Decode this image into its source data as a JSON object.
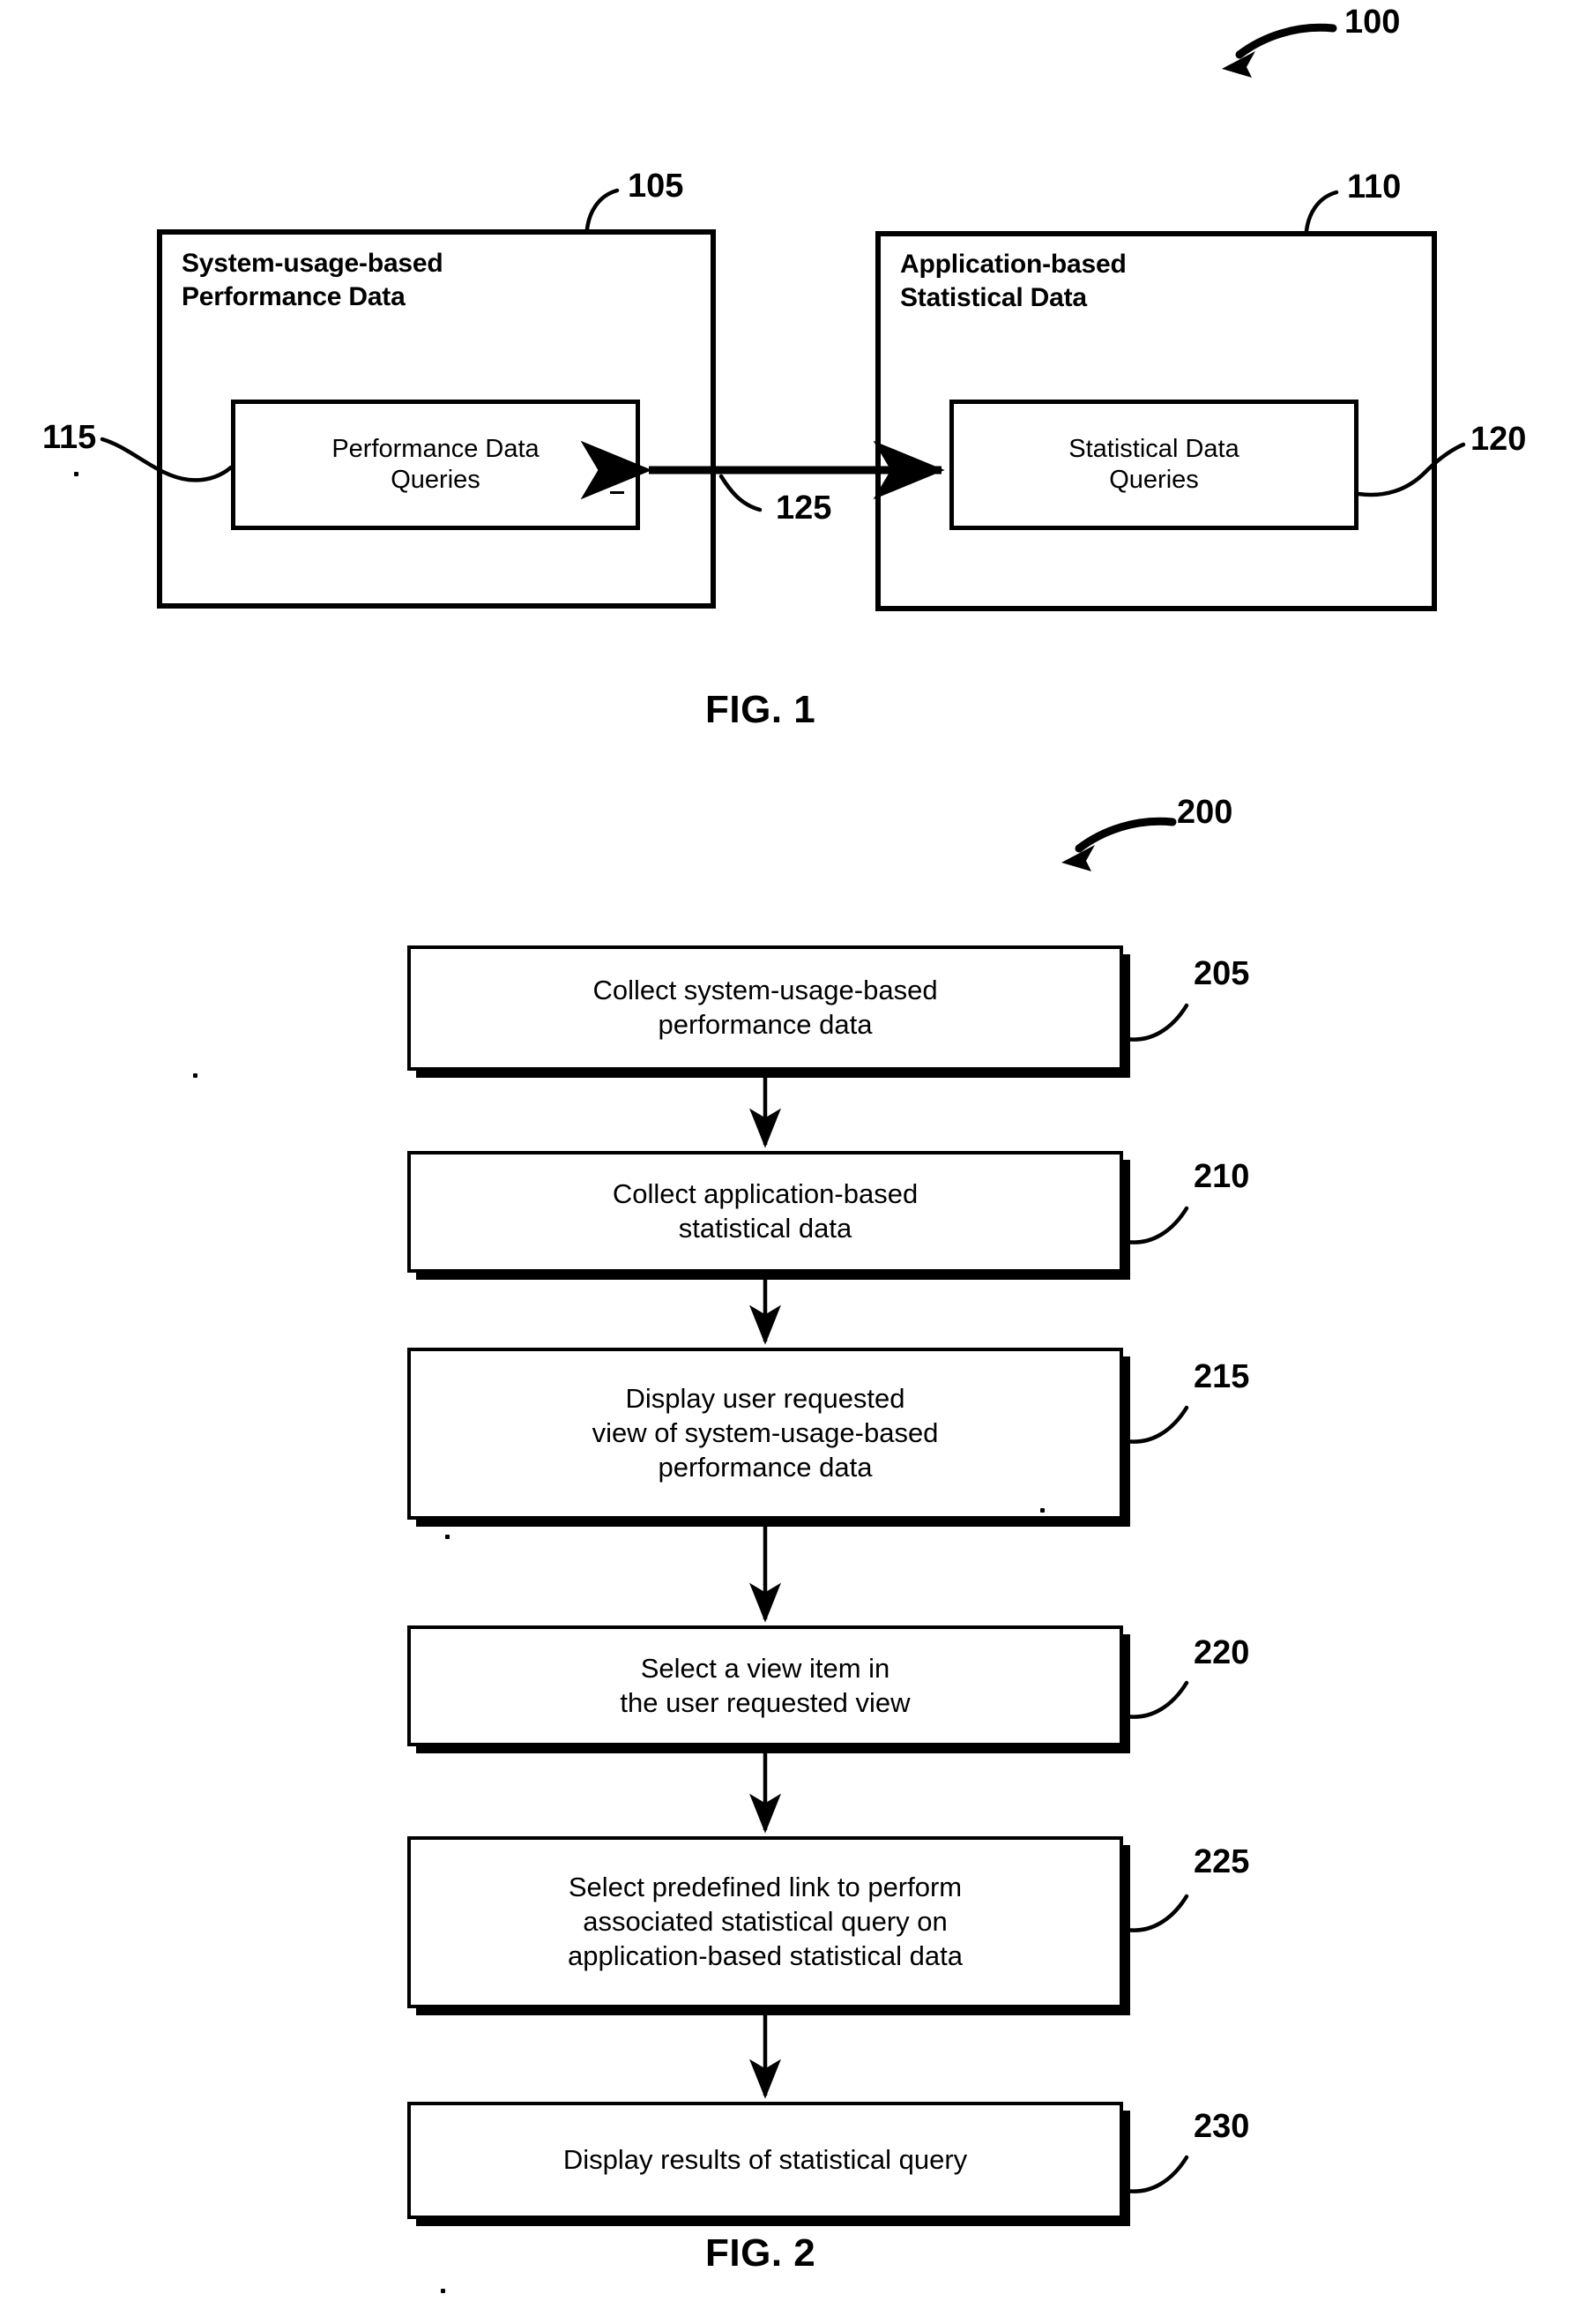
{
  "document": {
    "type": "patent-drawing-sheet",
    "figures": [
      "FIG. 1",
      "FIG. 2"
    ]
  },
  "fig1": {
    "caption": "FIG. 1",
    "system_ref": "100",
    "blocks": [
      {
        "ref": "105",
        "title": "System-usage-based\nPerformance Data",
        "inner": {
          "ref": "115",
          "label": "Performance Data\nQueries"
        }
      },
      {
        "ref": "110",
        "title": "Application-based\nStatistical Data",
        "inner": {
          "ref": "120",
          "label": "Statistical Data\nQueries"
        }
      }
    ],
    "connector": {
      "ref": "125",
      "kind": "bidirectional-arrow"
    }
  },
  "fig2": {
    "caption": "FIG. 2",
    "method_ref": "200",
    "steps": [
      {
        "ref": "205",
        "text": "Collect system-usage-based\nperformance data"
      },
      {
        "ref": "210",
        "text": "Collect application-based\nstatistical data"
      },
      {
        "ref": "215",
        "text": "Display user requested\nview of system-usage-based\nperformance data"
      },
      {
        "ref": "220",
        "text": "Select a view item in\nthe user requested view"
      },
      {
        "ref": "225",
        "text": "Select predefined link to perform\nassociated statistical query on\napplication-based statistical data"
      },
      {
        "ref": "230",
        "text": "Display results of statistical query"
      }
    ]
  }
}
